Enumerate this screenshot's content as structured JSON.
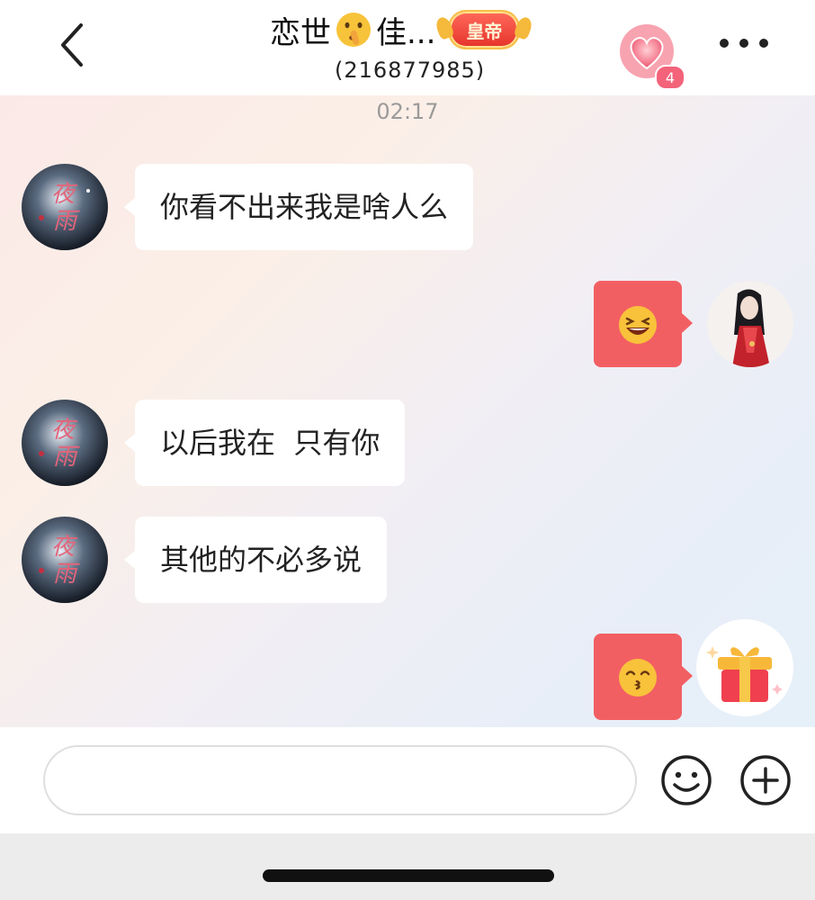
{
  "header": {
    "title_left": "恋世",
    "title_right": "佳...",
    "title_emoji": "shushing-face-emoji",
    "badge_label": "皇帝",
    "subtitle": "(216877985)",
    "heart_count": "4",
    "icons": [
      "back-chevron-icon",
      "heart-icon",
      "more-icon"
    ]
  },
  "chat": {
    "timestamp": "02:17",
    "messages": [
      {
        "side": "left",
        "text": "你看不出来我是啥人么"
      },
      {
        "side": "right",
        "content": "laughing-emoji"
      },
      {
        "side": "left",
        "text": "以后我在  只有你"
      },
      {
        "side": "left",
        "text": "其他的不必多说"
      },
      {
        "side": "right",
        "content": "kissing-emoji"
      }
    ],
    "left_avatar_text": "夜雨"
  },
  "input": {
    "placeholder": "",
    "icons": [
      "smiley-icon",
      "plus-icon"
    ]
  },
  "colors": {
    "bubble_right": "#f25f63",
    "bubble_left": "#ffffff",
    "badge": "#e5332a",
    "heart": "#f3637a"
  }
}
